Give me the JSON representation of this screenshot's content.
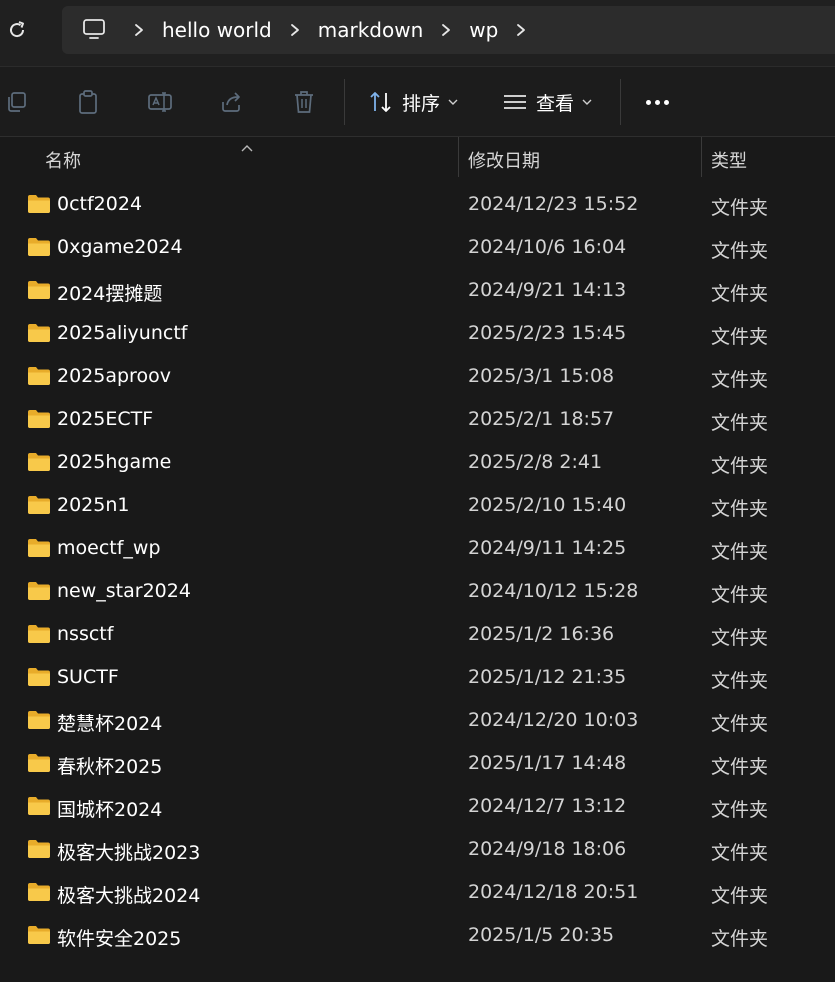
{
  "address_bar": {
    "refresh_icon": "refresh-icon",
    "computer_icon": "computer-icon",
    "breadcrumbs": [
      "hello world",
      "markdown",
      "wp"
    ]
  },
  "toolbar": {
    "icons": [
      "copy-icon",
      "paste-icon",
      "rename-icon",
      "share-icon",
      "delete-icon"
    ],
    "sort_label": "排序",
    "view_label": "查看",
    "more_icon": "more-icon"
  },
  "columns": {
    "name": "名称",
    "modified": "修改日期",
    "type": "类型"
  },
  "rows": [
    {
      "name": "0ctf2024",
      "modified": "2024/12/23 15:52",
      "type": "文件夹"
    },
    {
      "name": "0xgame2024",
      "modified": "2024/10/6 16:04",
      "type": "文件夹"
    },
    {
      "name": "2024摆摊题",
      "modified": "2024/9/21 14:13",
      "type": "文件夹"
    },
    {
      "name": "2025aliyunctf",
      "modified": "2025/2/23 15:45",
      "type": "文件夹"
    },
    {
      "name": "2025aproov",
      "modified": "2025/3/1 15:08",
      "type": "文件夹"
    },
    {
      "name": "2025ECTF",
      "modified": "2025/2/1 18:57",
      "type": "文件夹"
    },
    {
      "name": "2025hgame",
      "modified": "2025/2/8 2:41",
      "type": "文件夹"
    },
    {
      "name": "2025n1",
      "modified": "2025/2/10 15:40",
      "type": "文件夹"
    },
    {
      "name": "moectf_wp",
      "modified": "2024/9/11 14:25",
      "type": "文件夹"
    },
    {
      "name": "new_star2024",
      "modified": "2024/10/12 15:28",
      "type": "文件夹"
    },
    {
      "name": "nssctf",
      "modified": "2025/1/2 16:36",
      "type": "文件夹"
    },
    {
      "name": "SUCTF",
      "modified": "2025/1/12 21:35",
      "type": "文件夹"
    },
    {
      "name": "楚慧杯2024",
      "modified": "2024/12/20 10:03",
      "type": "文件夹"
    },
    {
      "name": "春秋杯2025",
      "modified": "2025/1/17 14:48",
      "type": "文件夹"
    },
    {
      "name": "国城杯2024",
      "modified": "2024/12/7 13:12",
      "type": "文件夹"
    },
    {
      "name": "极客大挑战2023",
      "modified": "2024/9/18 18:06",
      "type": "文件夹"
    },
    {
      "name": "极客大挑战2024",
      "modified": "2024/12/18 20:51",
      "type": "文件夹"
    },
    {
      "name": "软件安全2025",
      "modified": "2025/1/5 20:35",
      "type": "文件夹"
    }
  ],
  "colors": {
    "folder": "#f8c94a",
    "background": "#191919",
    "toolbar_icon_disabled": "#5d6c7c"
  }
}
